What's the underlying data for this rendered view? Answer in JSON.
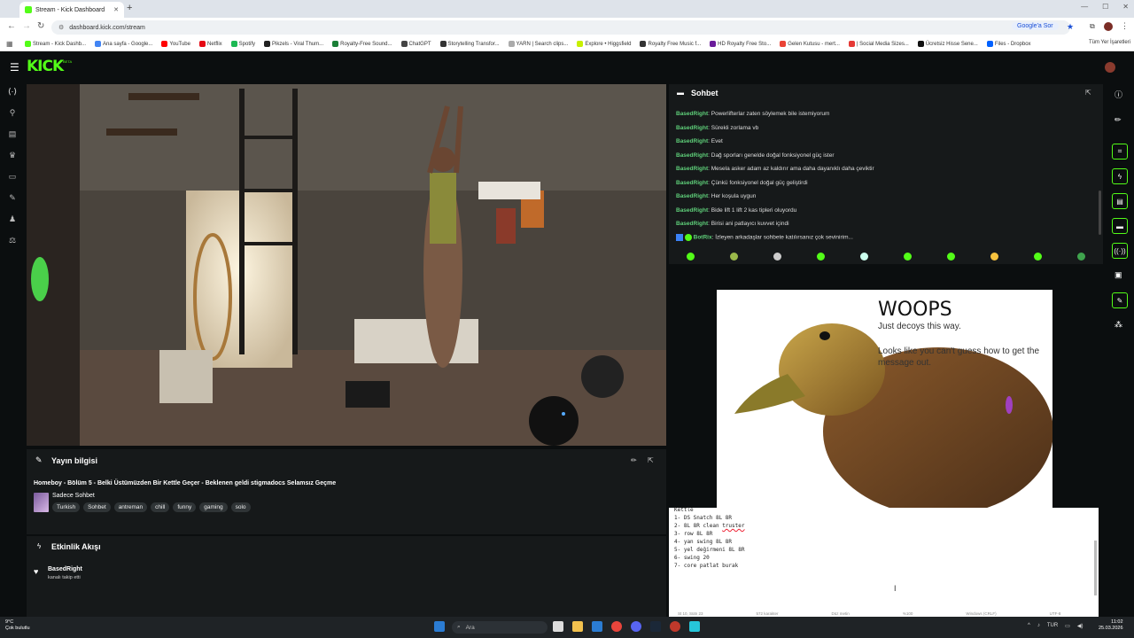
{
  "browser": {
    "tab_title": "Stream - Kick Dashboard",
    "url": "dashboard.kick.com/stream",
    "google_sor": "Google'a Sor",
    "all_bookmarks": "Tüm Yer İşaretleri",
    "bookmarks": [
      {
        "label": "Stream - Kick Dashb...",
        "color": "#53fc18"
      },
      {
        "label": "Ana sayfa - Google...",
        "color": "#4285f4"
      },
      {
        "label": "YouTube",
        "color": "#ff0000"
      },
      {
        "label": "Netflix",
        "color": "#e50914"
      },
      {
        "label": "Spotify",
        "color": "#1db954"
      },
      {
        "label": "Pikzels - Viral Thum...",
        "color": "#222222"
      },
      {
        "label": "Royalty-Free Sound...",
        "color": "#1a7f37"
      },
      {
        "label": "ChatGPT",
        "color": "#444444"
      },
      {
        "label": "Storytelling Transfor...",
        "color": "#333333"
      },
      {
        "label": "YARN | Search clips...",
        "color": "#aaaaaa"
      },
      {
        "label": "Explore • Higgsfield",
        "color": "#c7f000"
      },
      {
        "label": "Royalty Free Music f...",
        "color": "#333333"
      },
      {
        "label": "HD Royalty Free Sto...",
        "color": "#6a1b9a"
      },
      {
        "label": "Gelen Kutusu - mert...",
        "color": "#ea4335"
      },
      {
        "label": "| Social Media Sizes...",
        "color": "#e53935"
      },
      {
        "label": "Ücretsiz Hisse Sene...",
        "color": "#111111"
      },
      {
        "label": "Files - Dropbox",
        "color": "#0061ff"
      }
    ]
  },
  "kick": {
    "logo": "KICK",
    "beta": "BETA"
  },
  "stream_info": {
    "header": "Yayın bilgisi",
    "title": "Homeboy - Bölüm 5 - Belki Üstümüzden Bir Kettle Geçer - Beklenen geldi stigmadocs Selamsız Geçme",
    "category": "Sadece Sohbet",
    "tags": [
      "Turkish",
      "Sohbet",
      "antreman",
      "chill",
      "funny",
      "gaming",
      "solo"
    ]
  },
  "activity": {
    "header": "Etkinlik Akışı",
    "user": "BasedRight",
    "desc": "kanalı takip etti"
  },
  "chat": {
    "header": "Sohbet",
    "messages": [
      {
        "user": "BasedRight",
        "text": "Powerlifterlar zaten söylemek bile istemiyorum"
      },
      {
        "user": "BasedRight",
        "text": "Sürekli zorlama vb"
      },
      {
        "user": "BasedRight",
        "text": "Evet"
      },
      {
        "user": "BasedRight",
        "text": "Dağ sporları genelde doğal fonksiyonel güç ister"
      },
      {
        "user": "BasedRight",
        "text": "Mesela asker adam az kaldırır ama daha dayanıklı daha çeviktir"
      },
      {
        "user": "BasedRight",
        "text": "Çünkü fonksiyonel doğal güç geliştirdi"
      },
      {
        "user": "BasedRight",
        "text": "Her koşula uygun"
      },
      {
        "user": "BasedRight",
        "text": "Bide lift 1 lift 2 kas tipleri oluyordu"
      },
      {
        "user": "BasedRight",
        "text": "Birisi ani patlayıcı kuvvet içindi"
      }
    ],
    "bot": {
      "user": "BotRix",
      "text": "İzleyen arkadaşlar sohbete katılırsanız çok sevinirim..."
    }
  },
  "overlay": {
    "woops": "WOOPS",
    "sub": "Just decoys this way.",
    "msg": "Looks like you can't guess how to get the message out."
  },
  "notepad": {
    "heading": "Kettle",
    "lines": [
      "1- DS Snatch 8L 8R",
      "2- 8L 8R clean truster",
      "3- row 8L 8R",
      "4- yan swing 8L 8R",
      "5- yel değirmeni 8L 8R",
      "6- swing 20",
      "7- core patlat burak"
    ],
    "status_pos": "St 10, Sütn 23",
    "status_chars": "572 karakter",
    "status_type": "Düz metin",
    "status_zoom": "%100",
    "status_eol": "Windows (CRLF)",
    "status_enc": "UTF-8"
  },
  "taskbar": {
    "temp": "9°C",
    "weather": "Çok bulutlu",
    "search": "Ara",
    "lang": "TUR",
    "time": "11:02",
    "date": "25.03.2026"
  }
}
